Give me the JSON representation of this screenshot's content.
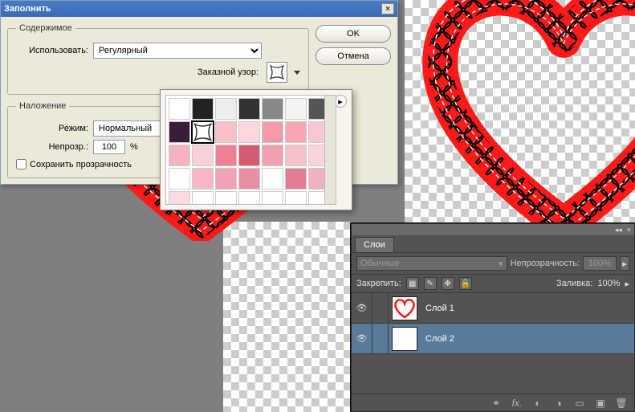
{
  "dialog": {
    "title": "Заполнить",
    "ok": "OK",
    "cancel": "Отмена",
    "contents_legend": "Содержимое",
    "use_label": "Использовать:",
    "use_value": "Регулярный",
    "custom_pattern_label": "Заказной узор:",
    "blending_legend": "Наложение",
    "mode_label": "Режим:",
    "mode_value": "Нормальный",
    "opacity_label": "Непрозр.:",
    "opacity_value": "100",
    "opacity_suffix": "%",
    "preserve_label": "Сохранить прозрачность"
  },
  "pattern_popup": {
    "rows": 5,
    "cols": 7,
    "selected_index": 8,
    "colors": [
      "#fff",
      "#222",
      "#eee",
      "#333",
      "#888",
      "#f3f3f3",
      "#555",
      "#3a1d3a",
      "#fff",
      "#f8bfc6",
      "#ffd6dc",
      "#f49ba7",
      "#f7a6b2",
      "#f9c7d0",
      "#f4b3be",
      "#f8d1d8",
      "#ef7f93",
      "#d25a71",
      "#f29fb0",
      "#f6c1cb",
      "#f8d5db",
      "#fff",
      "#f6b7c3",
      "#f1a3b3",
      "#e88fa2",
      "#fff",
      "#e37e92",
      "#f3b1bf",
      "#f9dbe1",
      "#fff",
      "#fff",
      "#fff",
      "#fff",
      "#fff",
      "#fff"
    ]
  },
  "layers_panel": {
    "tab": "Слои",
    "blend_mode": "Обычные",
    "opacity_label": "Непрозрачность:",
    "opacity_value": "100%",
    "lock_label": "Закрепить:",
    "fill_label": "Заливка:",
    "fill_value": "100%",
    "layers": [
      {
        "name": "Слой 1",
        "selected": false,
        "thumb": "heart"
      },
      {
        "name": "Слой 2",
        "selected": true,
        "thumb": "checker"
      }
    ],
    "footer_icons": [
      "link-icon",
      "fx-icon",
      "mask-icon",
      "adjustment-icon",
      "group-icon",
      "new-icon",
      "trash-icon"
    ]
  },
  "chart_data": null
}
